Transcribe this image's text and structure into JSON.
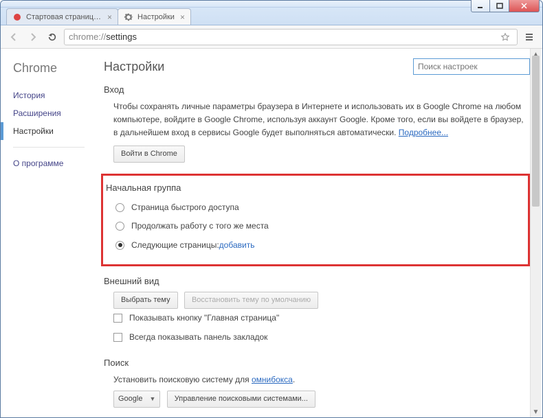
{
  "window": {
    "tabs": [
      {
        "label": "Стартовая страница: что",
        "favicon": "red"
      },
      {
        "label": "Настройки",
        "favicon": "gear"
      }
    ]
  },
  "omnibox": {
    "prefix": "chrome://",
    "path": "settings"
  },
  "sidebar": {
    "brand": "Chrome",
    "items": {
      "history": "История",
      "extensions": "Расширения",
      "settings": "Настройки",
      "about": "О программе"
    }
  },
  "page": {
    "title": "Настройки",
    "search_placeholder": "Поиск настроек"
  },
  "sections": {
    "signin": {
      "title": "Вход",
      "body": "Чтобы сохранять личные параметры браузера в Интернете и использовать их в Google Chrome на любом компьютере, войдите в Google Chrome, используя аккаунт Google. Кроме того, если вы войдете в браузер, в дальнейшем вход в сервисы Google будет выполняться автоматически. ",
      "more_link": "Подробнее...",
      "signin_button": "Войти в Chrome"
    },
    "startup": {
      "title": "Начальная группа",
      "radios": {
        "ntp": "Страница быстрого доступа",
        "continue": "Продолжать работу с того же места",
        "pages_prefix": "Следующие страницы: ",
        "pages_link": "добавить"
      }
    },
    "appearance": {
      "title": "Внешний вид",
      "choose_theme": "Выбрать тему",
      "reset_theme": "Восстановить тему по умолчанию",
      "show_home": "Показывать кнопку \"Главная страница\"",
      "show_bookmarks": "Всегда показывать панель закладок"
    },
    "search": {
      "title": "Поиск",
      "desc_prefix": "Установить поисковую систему для ",
      "omnibox_link": "омнибокса",
      "engine": "Google",
      "manage": "Управление поисковыми системами..."
    }
  }
}
